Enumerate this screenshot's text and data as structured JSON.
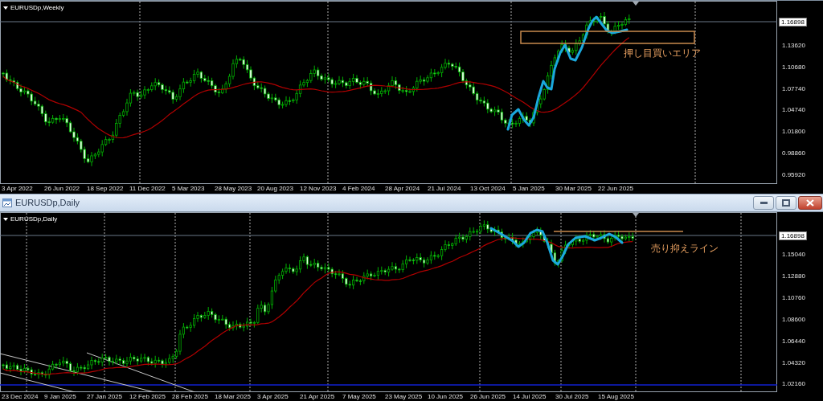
{
  "weekly_chart": {
    "label": "EURUSDp,Weekly",
    "current_price": "1.16898",
    "price_labels": [
      "1.13620",
      "1.10680",
      "1.07740",
      "1.04740",
      "1.01800",
      "0.98860",
      "0.95920"
    ],
    "date_labels": [
      "3 Apr 2022",
      "26 Jun 2022",
      "18 Sep 2022",
      "11 Dec 2022",
      "5 Mar 2023",
      "28 May 2023",
      "20 Aug 2023",
      "12 Nov 2023",
      "4 Feb 2024",
      "28 Apr 2024",
      "21 Jul 2024",
      "13 Oct 2024",
      "5 Jan 2025",
      "30 Mar 2025",
      "22 Jun 2025"
    ],
    "annotation": "押し目買いエリア"
  },
  "daily_window": {
    "title": "EURUSDp,Daily",
    "label": "EURUSDp,Daily",
    "current_price": "1.16898",
    "price_labels": [
      "1.15040",
      "1.12880",
      "1.10760",
      "1.08600",
      "1.06440",
      "1.04320",
      "1.02160"
    ],
    "date_labels": [
      "23 Dec 2024",
      "9 Jan 2025",
      "27 Jan 2025",
      "12 Feb 2025",
      "28 Feb 2025",
      "18 Mar 2025",
      "3 Apr 2025",
      "21 Apr 2025",
      "7 May 2025",
      "23 May 2025",
      "10 Jun 2025",
      "26 Jun 2025",
      "14 Jul 2025",
      "30 Jul 2025",
      "15 Aug 2025"
    ],
    "annotation": "売り抑えライン"
  }
}
